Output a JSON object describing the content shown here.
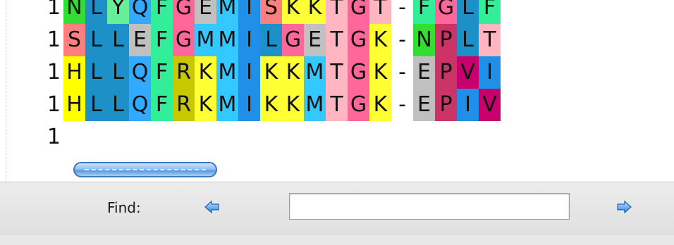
{
  "alignment": {
    "rows": [
      {
        "number": "1",
        "residues": [
          "N",
          "L",
          "Y",
          "Q",
          "F",
          "G",
          "E",
          "M",
          "I",
          "S",
          "K",
          "K",
          "T",
          "G",
          "T",
          "-",
          "F",
          "G",
          "L",
          "F"
        ]
      },
      {
        "number": "1",
        "residues": [
          "S",
          "L",
          "L",
          "E",
          "F",
          "G",
          "M",
          "M",
          "I",
          "L",
          "G",
          "E",
          "T",
          "G",
          "K",
          "-",
          "N",
          "P",
          "L",
          "T"
        ]
      },
      {
        "number": "1",
        "residues": [
          "H",
          "L",
          "L",
          "Q",
          "F",
          "R",
          "K",
          "M",
          "I",
          "K",
          "K",
          "M",
          "T",
          "G",
          "K",
          "-",
          "E",
          "P",
          "V",
          "I"
        ]
      },
      {
        "number": "1",
        "residues": [
          "H",
          "L",
          "L",
          "Q",
          "F",
          "R",
          "K",
          "M",
          "I",
          "K",
          "K",
          "M",
          "T",
          "G",
          "K",
          "-",
          "E",
          "P",
          "I",
          "V"
        ]
      },
      {
        "number": "1",
        "residues": []
      }
    ],
    "residue_colors": {
      "A": "#3399ff",
      "C": "#f08080",
      "D": "#cc33cc",
      "E": "#c0c0c0",
      "F": "#33ee99",
      "G": "#ff6699",
      "H": "#ffff00",
      "I": "#1f8fe8",
      "K": "#ffff33",
      "L": "#1e90c8",
      "M": "#33c8ff",
      "N": "#33dd33",
      "P": "#cc3366",
      "Q": "#33aaff",
      "R": "#c8c800",
      "S": "#ff7f7f",
      "T": "#ffb6c1",
      "V": "#c8006e",
      "W": "#9933cc",
      "Y": "#66ee99",
      "-": "#ffffff"
    }
  },
  "find_bar": {
    "label": "Find:",
    "input_value": "",
    "prev_icon": "left-arrow-icon",
    "next_icon": "right-arrow-icon"
  }
}
